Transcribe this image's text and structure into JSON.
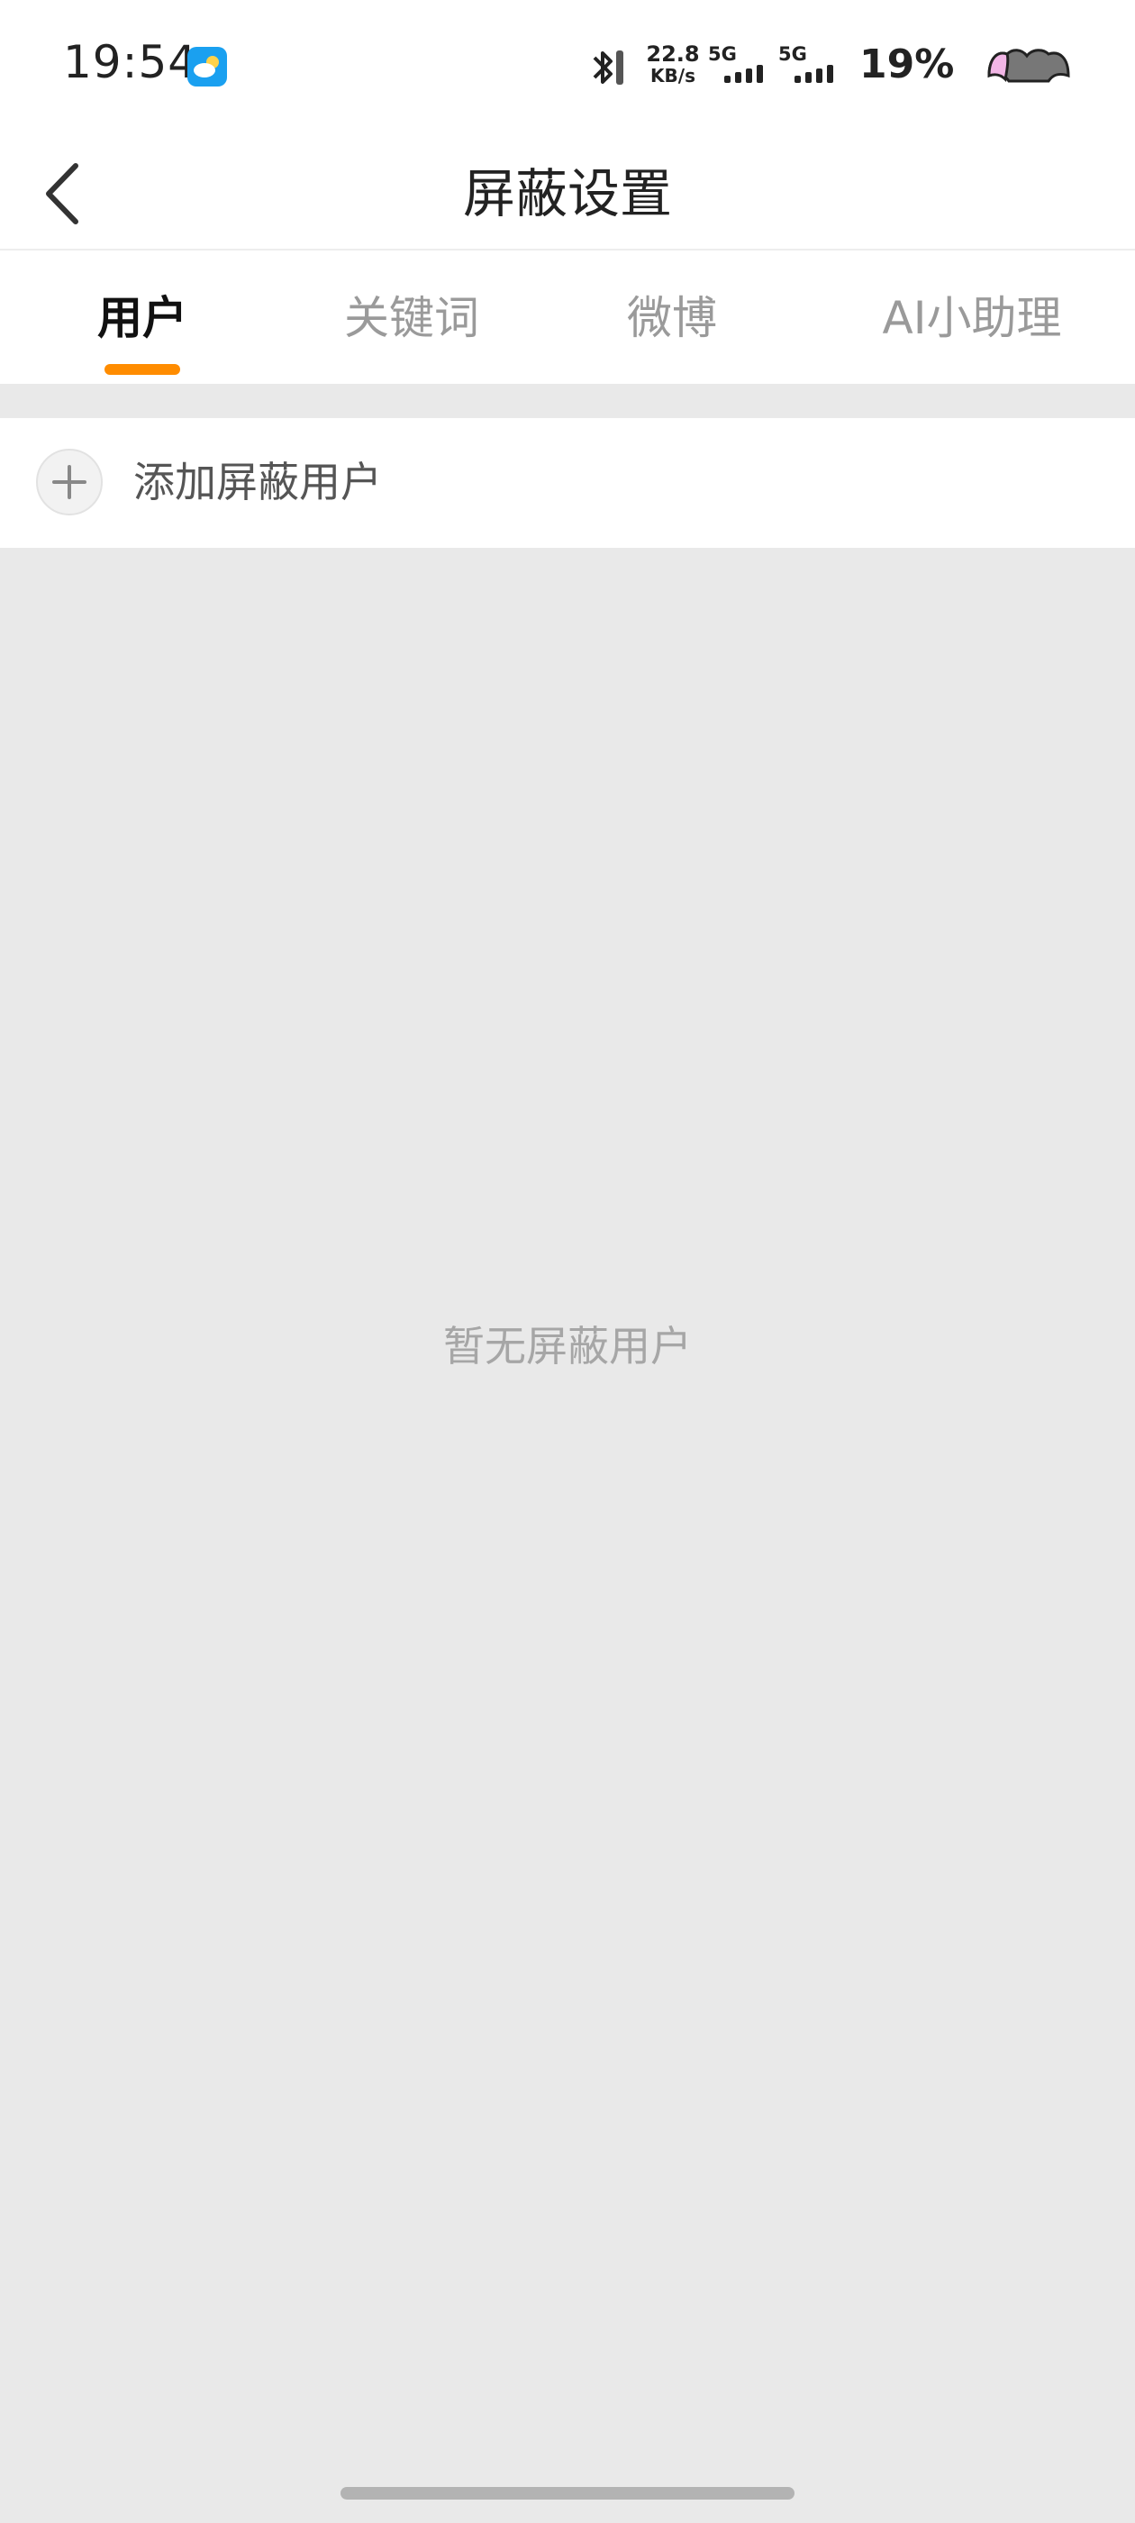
{
  "status_bar": {
    "time": "19:54",
    "net_speed_value": "22.8",
    "net_speed_unit": "KB/s",
    "signal1_label": "5G",
    "signal2_label": "5G",
    "battery_percent": "19%"
  },
  "header": {
    "title": "屏蔽设置"
  },
  "tabs": [
    {
      "label": "用户",
      "active": true
    },
    {
      "label": "关键词",
      "active": false
    },
    {
      "label": "微博",
      "active": false
    },
    {
      "label": "AI小助理",
      "active": false
    }
  ],
  "add_row": {
    "label": "添加屏蔽用户"
  },
  "empty_state": {
    "text": "暂无屏蔽用户"
  },
  "colors": {
    "accent": "#ff8c00",
    "background": "#e9e9e9"
  }
}
